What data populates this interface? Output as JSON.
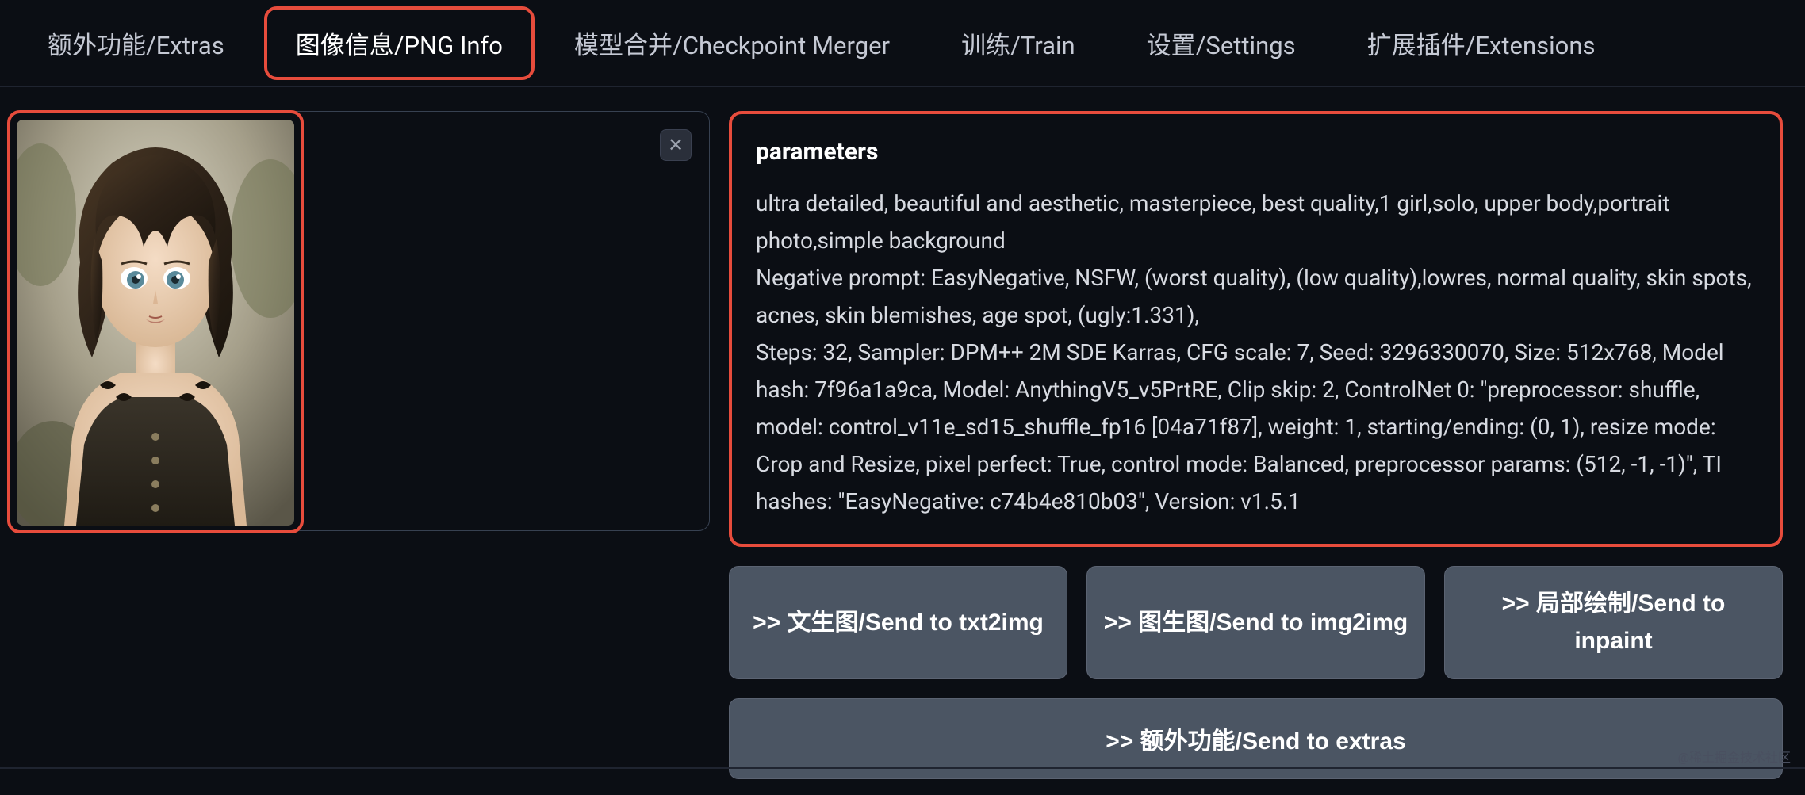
{
  "tabs": {
    "extras": "额外功能/Extras",
    "png_info": "图像信息/PNG Info",
    "checkpoint_merger": "模型合并/Checkpoint Merger",
    "train": "训练/Train",
    "settings": "设置/Settings",
    "extensions": "扩展插件/Extensions"
  },
  "params": {
    "title": "parameters",
    "text": "ultra detailed, beautiful and aesthetic, masterpiece, best quality,1 girl,solo, upper body,portrait photo,simple background\nNegative prompt: EasyNegative, NSFW, (worst quality), (low quality),lowres, normal quality, skin spots, acnes, skin blemishes, age spot, (ugly:1.331),\nSteps: 32, Sampler: DPM++ 2M SDE Karras, CFG scale: 7, Seed: 3296330070, Size: 512x768, Model hash: 7f96a1a9ca, Model: AnythingV5_v5PrtRE, Clip skip: 2, ControlNet 0: \"preprocessor: shuffle, model: control_v11e_sd15_shuffle_fp16 [04a71f87], weight: 1, starting/ending: (0, 1), resize mode: Crop and Resize, pixel perfect: True, control mode: Balanced, preprocessor params: (512, -1, -1)\", TI hashes: \"EasyNegative: c74b4e810b03\", Version: v1.5.1"
  },
  "buttons": {
    "send_txt2img": ">> 文生图/Send to txt2img",
    "send_img2img": ">> 图生图/Send to img2img",
    "send_inpaint": ">> 局部绘制/Send to inpaint",
    "send_extras": ">> 额外功能/Send to extras"
  },
  "icons": {
    "close": "✕"
  },
  "watermark": "@稀土掘金技术社区"
}
